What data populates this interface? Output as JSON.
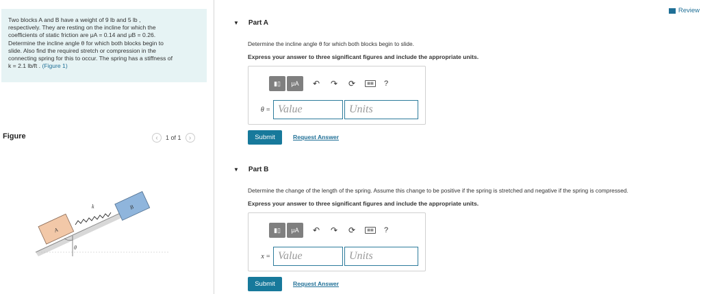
{
  "problem": {
    "l1": "Two blocks A and B have a weight of 9 lb and 5 lb ,",
    "l2": "respectively. They are resting on the incline for which the",
    "l3": "coefficients of static friction are μA = 0.14 and μB = 0.26.",
    "l4": "Determine the incline angle θ for which both blocks begin to",
    "l5": "slide. Also find the required stretch or compression in the",
    "l6": "connecting spring for this to occur. The spring has a stiffness of",
    "l7": "k = 2.1 lb/ft .",
    "figure_link": "(Figure 1)"
  },
  "figure": {
    "title": "Figure",
    "pager": "1 of 1",
    "label_a": "A",
    "label_b": "B",
    "label_k": "k",
    "label_theta": "θ"
  },
  "header": {
    "review": "Review"
  },
  "toolbar": {
    "mu_label": "μA",
    "help": "?"
  },
  "part_a": {
    "title": "Part A",
    "instruction": "Determine the incline angle θ for which both blocks begin to slide.",
    "express": "Express your answer to three significant figures and include the appropriate units.",
    "var": "θ =",
    "value_placeholder": "Value",
    "units_placeholder": "Units",
    "submit": "Submit",
    "request": "Request Answer"
  },
  "part_b": {
    "title": "Part B",
    "instruction": "Determine the change of the length of the spring. Assume this change to be positive if the spring is stretched and negative if the spring is compressed.",
    "express": "Express your answer to three significant figures and include the appropriate units.",
    "var": "x =",
    "value_placeholder": "Value",
    "units_placeholder": "Units",
    "submit": "Submit",
    "request": "Request Answer"
  }
}
